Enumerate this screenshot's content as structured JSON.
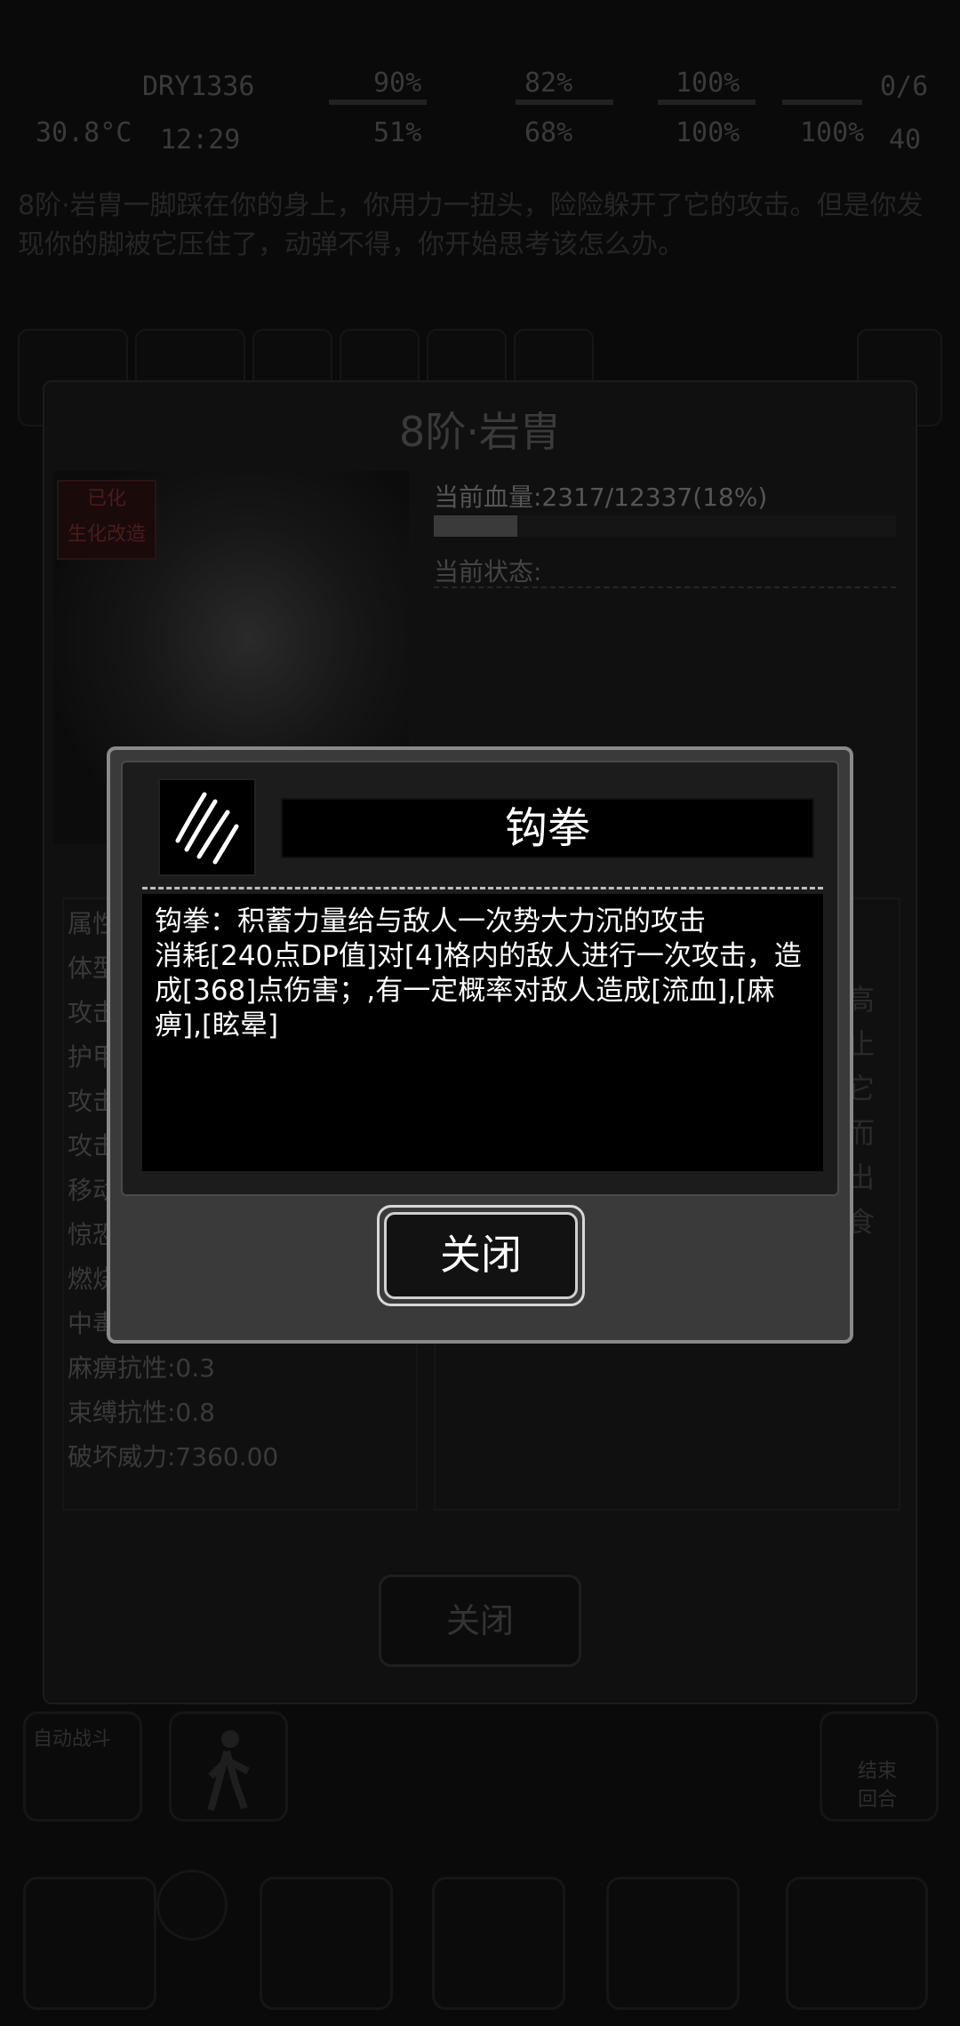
{
  "status": {
    "left_top": "DRY1336",
    "left_mid_a": "30.8°C",
    "left_mid_b": "12:29",
    "values": [
      "90%",
      "82%",
      "100%",
      "51%",
      "68%",
      "100%",
      "100%"
    ],
    "counters": [
      "0/6",
      "40"
    ]
  },
  "story_text": "8阶·岩胄一脚踩在你的身上，你用力一扭头，险险躲开了它的攻击。但是你发现你的脚被它压住了，动弹不得，你开始思考该怎么办。",
  "background_dialog": {
    "title": "8阶·岩胄",
    "badge_top": "已化",
    "badge_bottom": "生化改造",
    "hp_label": "当前血量:2317/12337(18%)",
    "hp_fraction": 0.18,
    "state_label": "当前状态:",
    "attributes": [
      "属性",
      "体型",
      "攻击",
      "护甲",
      "攻击",
      "攻击",
      "移动",
      "惊恐",
      "燃烧",
      "中毒",
      "麻痹抗性:0.3",
      "束缚抗性:0.8",
      "破坏威力:7360.00"
    ],
    "right_side_text": [
      "高",
      "止",
      "它",
      "而",
      "出",
      "食"
    ],
    "close_label": "关闭"
  },
  "bottom_bar": {
    "auto_label": "自动战斗",
    "end_turn_label": "结束回合"
  },
  "skill_popup": {
    "title": "钩拳",
    "icon": "claw-scratch-icon",
    "description_line1": "钩拳：积蓄力量给与敌人一次势大力沉的攻击",
    "description_line2": "消耗[240点DP值]对[4]格内的敌人进行一次攻击，造成[368]点伤害；,有一定概率对敌人造成[流血],[麻痹],[眩晕]",
    "close_label": "关闭"
  },
  "colors": {
    "popup_bg": "#3a3a3a",
    "popup_border": "#8a8a8a",
    "text": "#ffffff"
  }
}
